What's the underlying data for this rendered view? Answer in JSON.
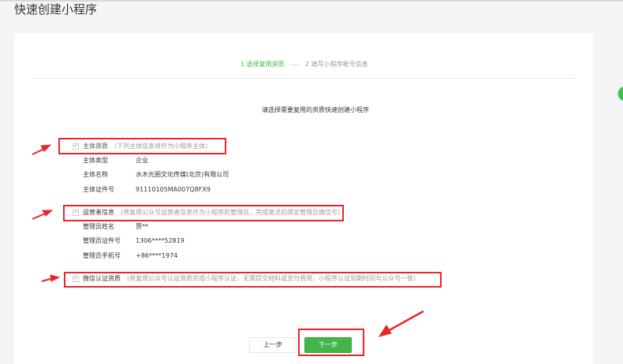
{
  "page": {
    "title": "快速创建小程序"
  },
  "steps": [
    {
      "label": "1 选择复用资质",
      "active": true
    },
    {
      "label": "2 填写小程序帐号信息",
      "active": false
    }
  ],
  "intro": "请选择需要复用的资质快速创建小程序",
  "sections": [
    {
      "label": "主体资质",
      "hint": "(下列主体信息将作为小程序主体)",
      "checked": true,
      "fields": [
        {
          "label": "主体类型",
          "value": "企业"
        },
        {
          "label": "主体名称",
          "value": "水木光圈文化传媒(北京)有限公司"
        },
        {
          "label": "主体证件号",
          "value": "91110105MA007Q8FX9"
        }
      ]
    },
    {
      "label": "运营者信息",
      "hint": "(将复用公众号运营者信息作为小程序的管理员，完成激活后绑定管理员微信号)",
      "checked": true,
      "fields": [
        {
          "label": "管理员姓名",
          "value": "贾**"
        },
        {
          "label": "管理员证件号",
          "value": "1306****52819"
        },
        {
          "label": "管理员手机号",
          "value": "+86****1974"
        }
      ]
    },
    {
      "label": "微信认证资质",
      "hint": "(将复用公众号认证资质完成小程序认证，无需提交材料或支付费用，小程序认证到期时间与公众号一致)",
      "checked": true,
      "fields": []
    }
  ],
  "buttons": {
    "prev": "上一步",
    "next": "下一步"
  },
  "colors": {
    "accent": "#44b549",
    "annotation": "#e8262a"
  },
  "icons": {
    "check": "✓"
  }
}
